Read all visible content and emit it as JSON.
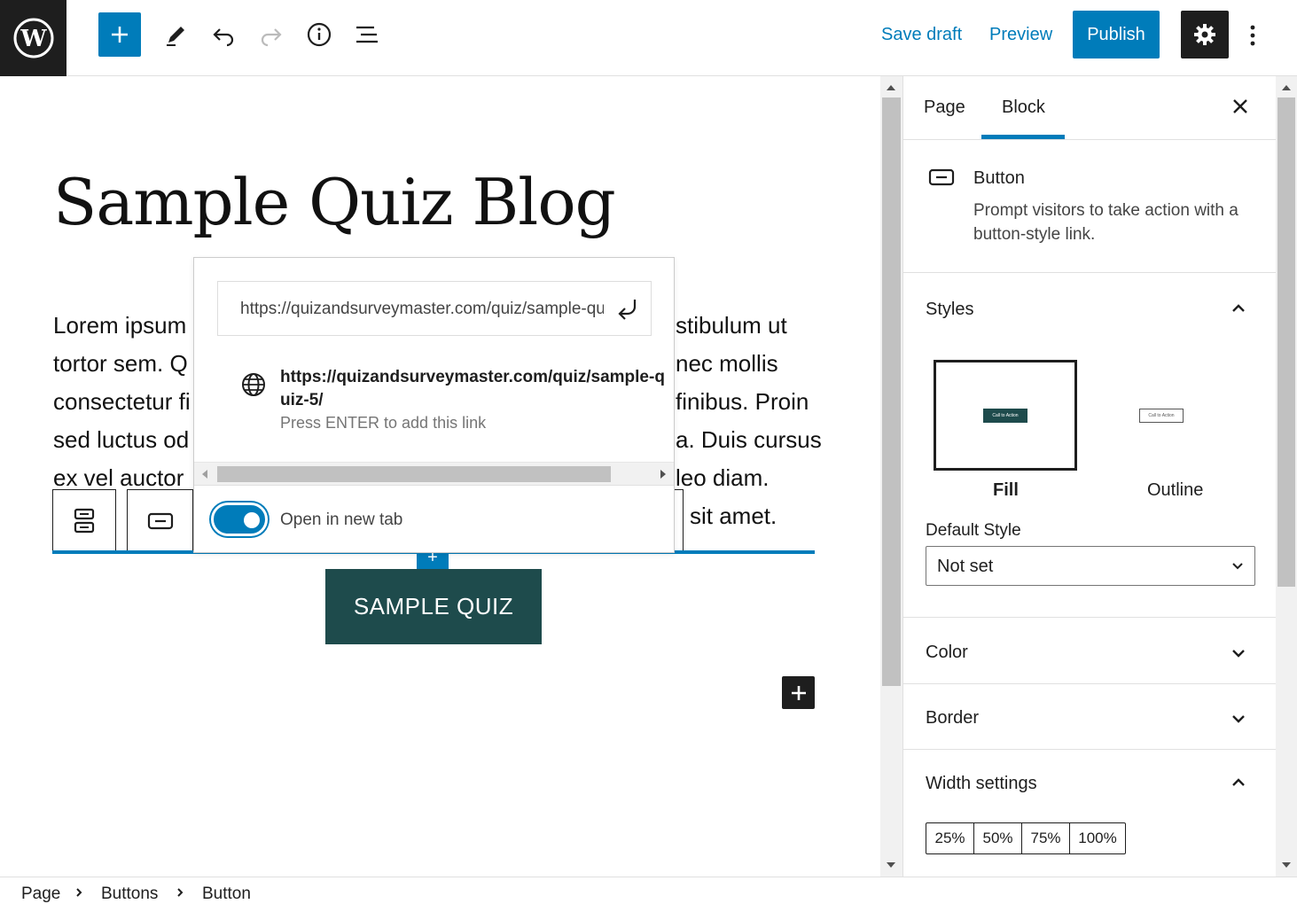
{
  "toolbar": {
    "save_draft": "Save draft",
    "preview": "Preview",
    "publish": "Publish",
    "icons": [
      "wordpress-icon",
      "plus-icon",
      "pencil-icon",
      "undo-icon",
      "redo-icon",
      "info-icon",
      "list-view-icon",
      "gear-icon",
      "more-vertical-icon"
    ],
    "accent": "#007cba"
  },
  "editor": {
    "title": "Sample Quiz Blog",
    "para_left": [
      "Lorem ipsum",
      "tortor sem. Q",
      "consectetur fi",
      "sed luctus od",
      "ex vel auctor"
    ],
    "para_right": [
      "stibulum ut",
      "nec mollis",
      "finibus. Proin",
      "a. Duis cursus",
      "leo diam.",
      "sit amet."
    ],
    "button_text": "SAMPLE QUIZ",
    "button_color": "#1e4b4c"
  },
  "link_popover": {
    "url_value": "https://quizandsurveymaster.com/quiz/sample-quiz-5/",
    "suggestion_url": "https://quizandsurveymaster.com/quiz/sample-quiz-5/",
    "suggestion_hint": "Press ENTER to add this link",
    "toggle_label": "Open in new tab",
    "toggle_on": true
  },
  "sidebar": {
    "tabs": [
      "Page",
      "Block"
    ],
    "active_tab": "Block",
    "block_name": "Button",
    "block_desc": "Prompt visitors to take action with a button-style link.",
    "styles_title": "Styles",
    "style_fill": "Fill",
    "style_outline": "Outline",
    "mini_label": "Call to Action",
    "default_style_label": "Default Style",
    "default_style_value": "Not set",
    "color_title": "Color",
    "border_title": "Border",
    "width_title": "Width settings",
    "widths": [
      "25%",
      "50%",
      "75%",
      "100%"
    ]
  },
  "breadcrumb": [
    "Page",
    "Buttons",
    "Button"
  ]
}
